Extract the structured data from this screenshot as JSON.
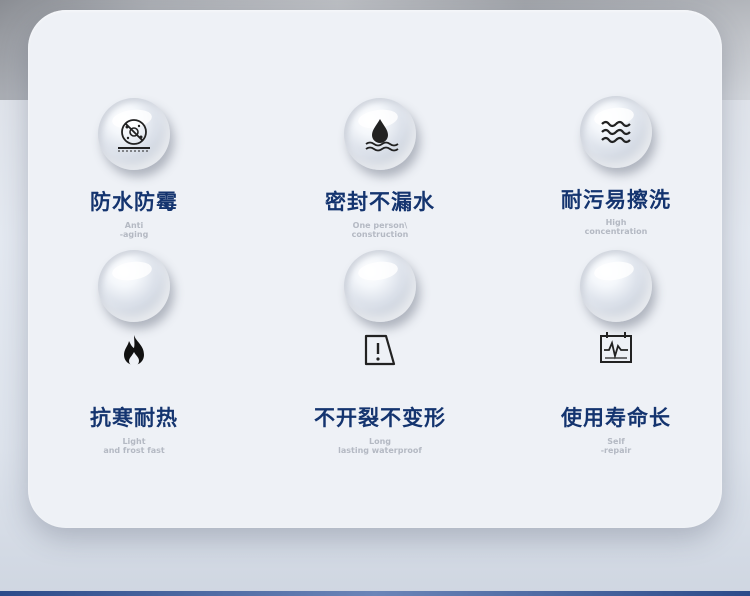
{
  "features": [
    {
      "title": "防水防霉",
      "sub1": "Anti",
      "sub2": "-aging",
      "icon": "anti-mold-icon"
    },
    {
      "title": "密封不漏水",
      "sub1": "One person\\",
      "sub2": "construction",
      "icon": "water-drop-icon"
    },
    {
      "title": "耐污易擦洗",
      "sub1": "High",
      "sub2": "concentration",
      "icon": "waves-icon"
    },
    {
      "title": "抗寒耐热",
      "sub1": "Light",
      "sub2": "and frost fast",
      "icon": "flame-icon"
    },
    {
      "title": "不开裂不变形",
      "sub1": "Long",
      "sub2": "lasting waterproof",
      "icon": "crack-warning-icon"
    },
    {
      "title": "使用寿命长",
      "sub1": "Self",
      "sub2": "-repair",
      "icon": "monitor-chart-icon"
    }
  ],
  "colors": {
    "title": "#14346f",
    "subtitle": "#b4b9c3",
    "card": "#eef1f6"
  }
}
